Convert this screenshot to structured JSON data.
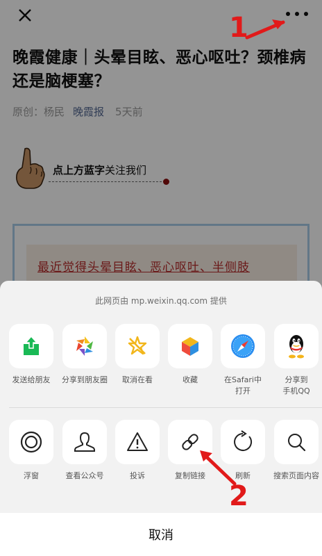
{
  "article": {
    "title": "晚霞健康｜头晕目眩、恶心呕吐？颈椎病还是脑梗塞？",
    "meta": {
      "original": "原创：杨民",
      "source": "晚霞报",
      "time": "5天前"
    },
    "follow_prefix": "点上方",
    "follow_blue": "蓝字",
    "follow_suffix": "关注我们",
    "box_text": "最近觉得头晕目眩、恶心呕吐、半侧肢"
  },
  "annotations": {
    "step1": "1",
    "step2": "2"
  },
  "share_sheet": {
    "provider": "此网页由 mp.weixin.qq.com 提供",
    "row1": [
      {
        "label": "发送给朋友",
        "icon": "share-arrow-icon"
      },
      {
        "label": "分享到朋友圈",
        "icon": "moments-icon"
      },
      {
        "label": "取消在看",
        "icon": "unwow-icon"
      },
      {
        "label": "收藏",
        "icon": "favorite-cube-icon"
      },
      {
        "label": "在Safari中\n打开",
        "icon": "safari-compass-icon"
      },
      {
        "label": "分享到\n手机QQ",
        "icon": "qq-penguin-icon"
      }
    ],
    "row2": [
      {
        "label": "浮窗",
        "icon": "float-window-icon"
      },
      {
        "label": "查看公众号",
        "icon": "official-account-icon"
      },
      {
        "label": "投诉",
        "icon": "report-warning-icon"
      },
      {
        "label": "复制链接",
        "icon": "link-icon"
      },
      {
        "label": "刷新",
        "icon": "refresh-icon"
      },
      {
        "label": "搜索页面内容",
        "icon": "search-icon"
      }
    ],
    "cancel": "取消"
  },
  "colors": {
    "accent_green": "#19b955",
    "link_blue": "#576b95",
    "annotation_red": "#e11a1a"
  }
}
